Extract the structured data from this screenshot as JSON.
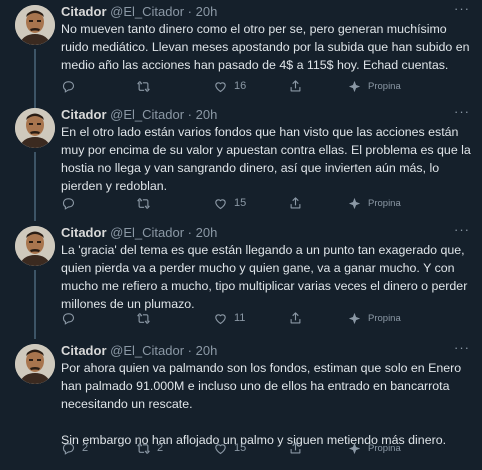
{
  "author": {
    "name": "Citador",
    "handle": "@El_Citador",
    "separator": "·"
  },
  "more_icon": "more-dots-icon",
  "tip_label": "Propina",
  "tweets": [
    {
      "time": "20h",
      "text": "No mueven tanto dinero como el otro per se, pero generan muchísimo ruido mediático. Llevan meses apostando por la subida que han subido en  medio año las acciones han pasado de 4$ a 115$ hoy. Echad cuentas.",
      "replies": "",
      "retweets": "",
      "likes": "16"
    },
    {
      "time": "20h",
      "text": "En el otro lado están varios fondos que han visto que las acciones están muy por encima de su valor y apuestan contra ellas. El problema es que la hostia no llega y van sangrando dinero, así que invierten aún más, lo pierden y redoblan.",
      "replies": "",
      "retweets": "",
      "likes": "15"
    },
    {
      "time": "20h",
      "text": "La 'gracia' del tema es que están llegando a un punto tan exagerado que, quien pierda va a perder mucho y quien gane, va a ganar mucho. Y con mucho me refiero a mucho, tipo multiplicar varias veces el dinero o perder millones de un plumazo.",
      "replies": "",
      "retweets": "",
      "likes": "11"
    },
    {
      "time": "20h",
      "text": "Por ahora quien va palmando son los fondos, estiman que solo en Enero han palmado 91.000M e incluso uno de ellos ha entrado en bancarrota necesitando un rescate.\n\nSin embargo no han aflojado un palmo y siguen metiendo más dinero.",
      "replies": "2",
      "retweets": "2",
      "likes": "15"
    }
  ]
}
